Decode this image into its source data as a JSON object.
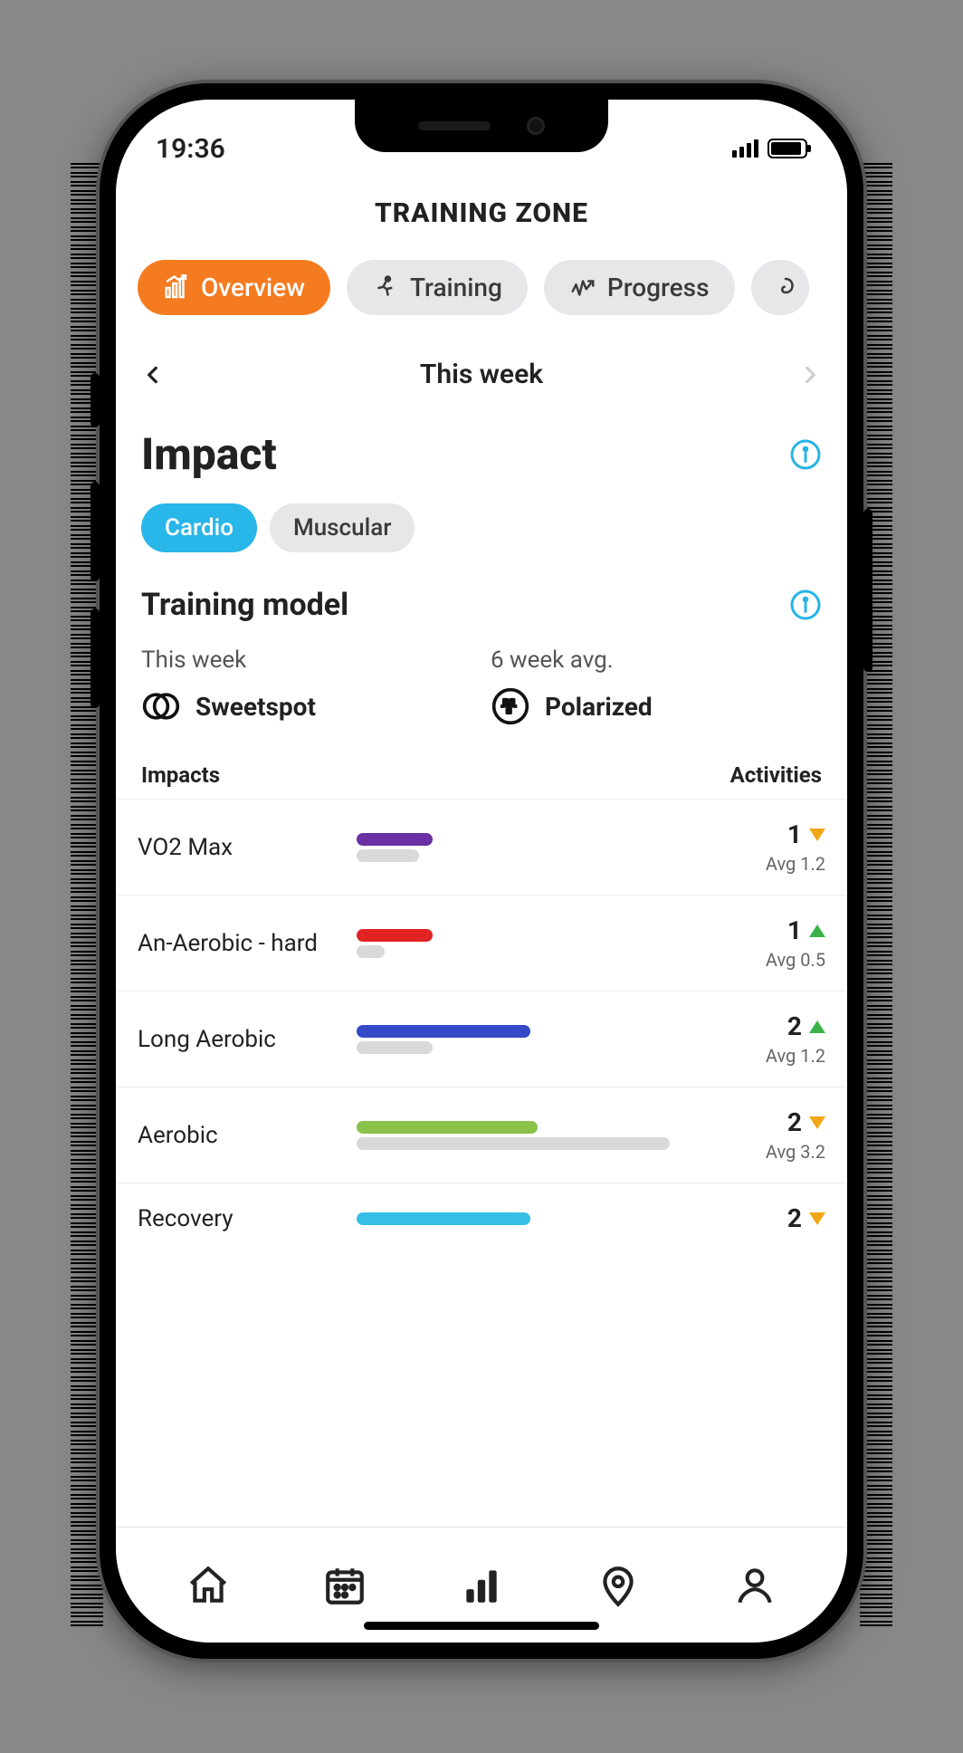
{
  "status": {
    "time": "19:36"
  },
  "header": {
    "title": "TRAINING ZONE"
  },
  "tabs": [
    {
      "id": "overview",
      "label": "Overview",
      "icon": "chart-up-icon",
      "active": true
    },
    {
      "id": "training",
      "label": "Training",
      "icon": "runner-icon",
      "active": false
    },
    {
      "id": "progress",
      "label": "Progress",
      "icon": "pulse-up-icon",
      "active": false
    },
    {
      "id": "peek",
      "label": "",
      "icon": "hook-icon",
      "active": false
    }
  ],
  "weeknav": {
    "label": "This week"
  },
  "impact": {
    "heading": "Impact",
    "filters": [
      {
        "id": "cardio",
        "label": "Cardio",
        "active": true
      },
      {
        "id": "muscular",
        "label": "Muscular",
        "active": false
      }
    ]
  },
  "training_model": {
    "heading": "Training model",
    "this_week": {
      "label": "This week",
      "value": "Sweetspot",
      "icon": "overlap-circles-icon"
    },
    "avg": {
      "label": "6 week avg.",
      "value": "Polarized",
      "icon": "pulse-circle-icon"
    }
  },
  "list": {
    "impacts_label": "Impacts",
    "activities_label": "Activities",
    "rows": [
      {
        "name": "VO2 Max",
        "color": "#6a2fa3",
        "bar_pct": 22,
        "avg_bar_pct": 18,
        "count": "1",
        "trend": "down",
        "avg_label": "Avg 1.2"
      },
      {
        "name": "An-Aerobic - hard",
        "color": "#e22323",
        "bar_pct": 22,
        "avg_bar_pct": 8,
        "count": "1",
        "trend": "up",
        "avg_label": "Avg 0.5"
      },
      {
        "name": "Long Aerobic",
        "color": "#3349c8",
        "bar_pct": 50,
        "avg_bar_pct": 22,
        "count": "2",
        "trend": "up",
        "avg_label": "Avg 1.2"
      },
      {
        "name": "Aerobic",
        "color": "#8bc34a",
        "bar_pct": 52,
        "avg_bar_pct": 90,
        "count": "2",
        "trend": "down",
        "avg_label": "Avg 3.2"
      },
      {
        "name": "Recovery",
        "color": "#35bfe6",
        "bar_pct": 50,
        "avg_bar_pct": 0,
        "count": "2",
        "trend": "down",
        "avg_label": ""
      }
    ]
  },
  "chart_data": {
    "type": "bar",
    "title": "Impacts — This week vs 6-week avg (activity count)",
    "categories": [
      "VO2 Max",
      "An-Aerobic - hard",
      "Long Aerobic",
      "Aerobic",
      "Recovery"
    ],
    "series": [
      {
        "name": "This week",
        "values": [
          1,
          1,
          2,
          2,
          2
        ]
      },
      {
        "name": "6-week avg",
        "values": [
          1.2,
          0.5,
          1.2,
          3.2,
          null
        ]
      }
    ],
    "xlabel": "",
    "ylabel": "Activities",
    "ylim": [
      0,
      4
    ]
  },
  "bottom_nav": [
    {
      "id": "home",
      "icon": "home-icon"
    },
    {
      "id": "calendar",
      "icon": "calendar-icon"
    },
    {
      "id": "stats",
      "icon": "bars-icon"
    },
    {
      "id": "places",
      "icon": "pin-icon"
    },
    {
      "id": "profile",
      "icon": "person-icon"
    }
  ]
}
